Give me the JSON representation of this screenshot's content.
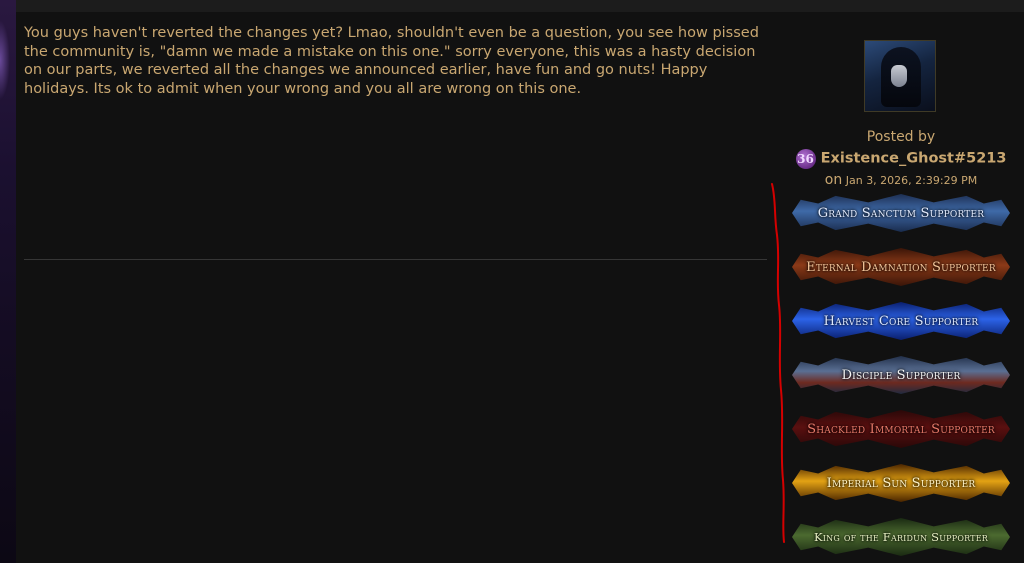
{
  "post": {
    "body": "You guys haven't reverted the changes yet? Lmao, shouldn't even be a question, you see how pissed the community is, \"damn we made a mistake on this one.\" sorry everyone, this was a hasty decision on our parts, we reverted all the changes we announced earlier, have fun and go nuts! Happy holidays. Its ok to admit when your wrong and you all are wrong on this one."
  },
  "author": {
    "posted_by_label": "Posted by",
    "level": "36",
    "name": "Existence_Ghost#5213",
    "date_prefix": "on",
    "date": "Jan 3, 2026, 2:39:29 PM",
    "avatar_icon": "hooded-figure-avatar"
  },
  "badges": [
    {
      "label": "Grand Sanctum Supporter"
    },
    {
      "label": "Eternal Damnation Supporter"
    },
    {
      "label": "Harvest Core Supporter"
    },
    {
      "label": "Disciple Supporter"
    },
    {
      "label": "Shackled Immortal Supporter"
    },
    {
      "label": "Imperial Sun Supporter"
    },
    {
      "label": "King of the Faridun Supporter"
    }
  ],
  "colors": {
    "text": "#c9a771",
    "background": "#111111",
    "annotation": "#d40000"
  }
}
